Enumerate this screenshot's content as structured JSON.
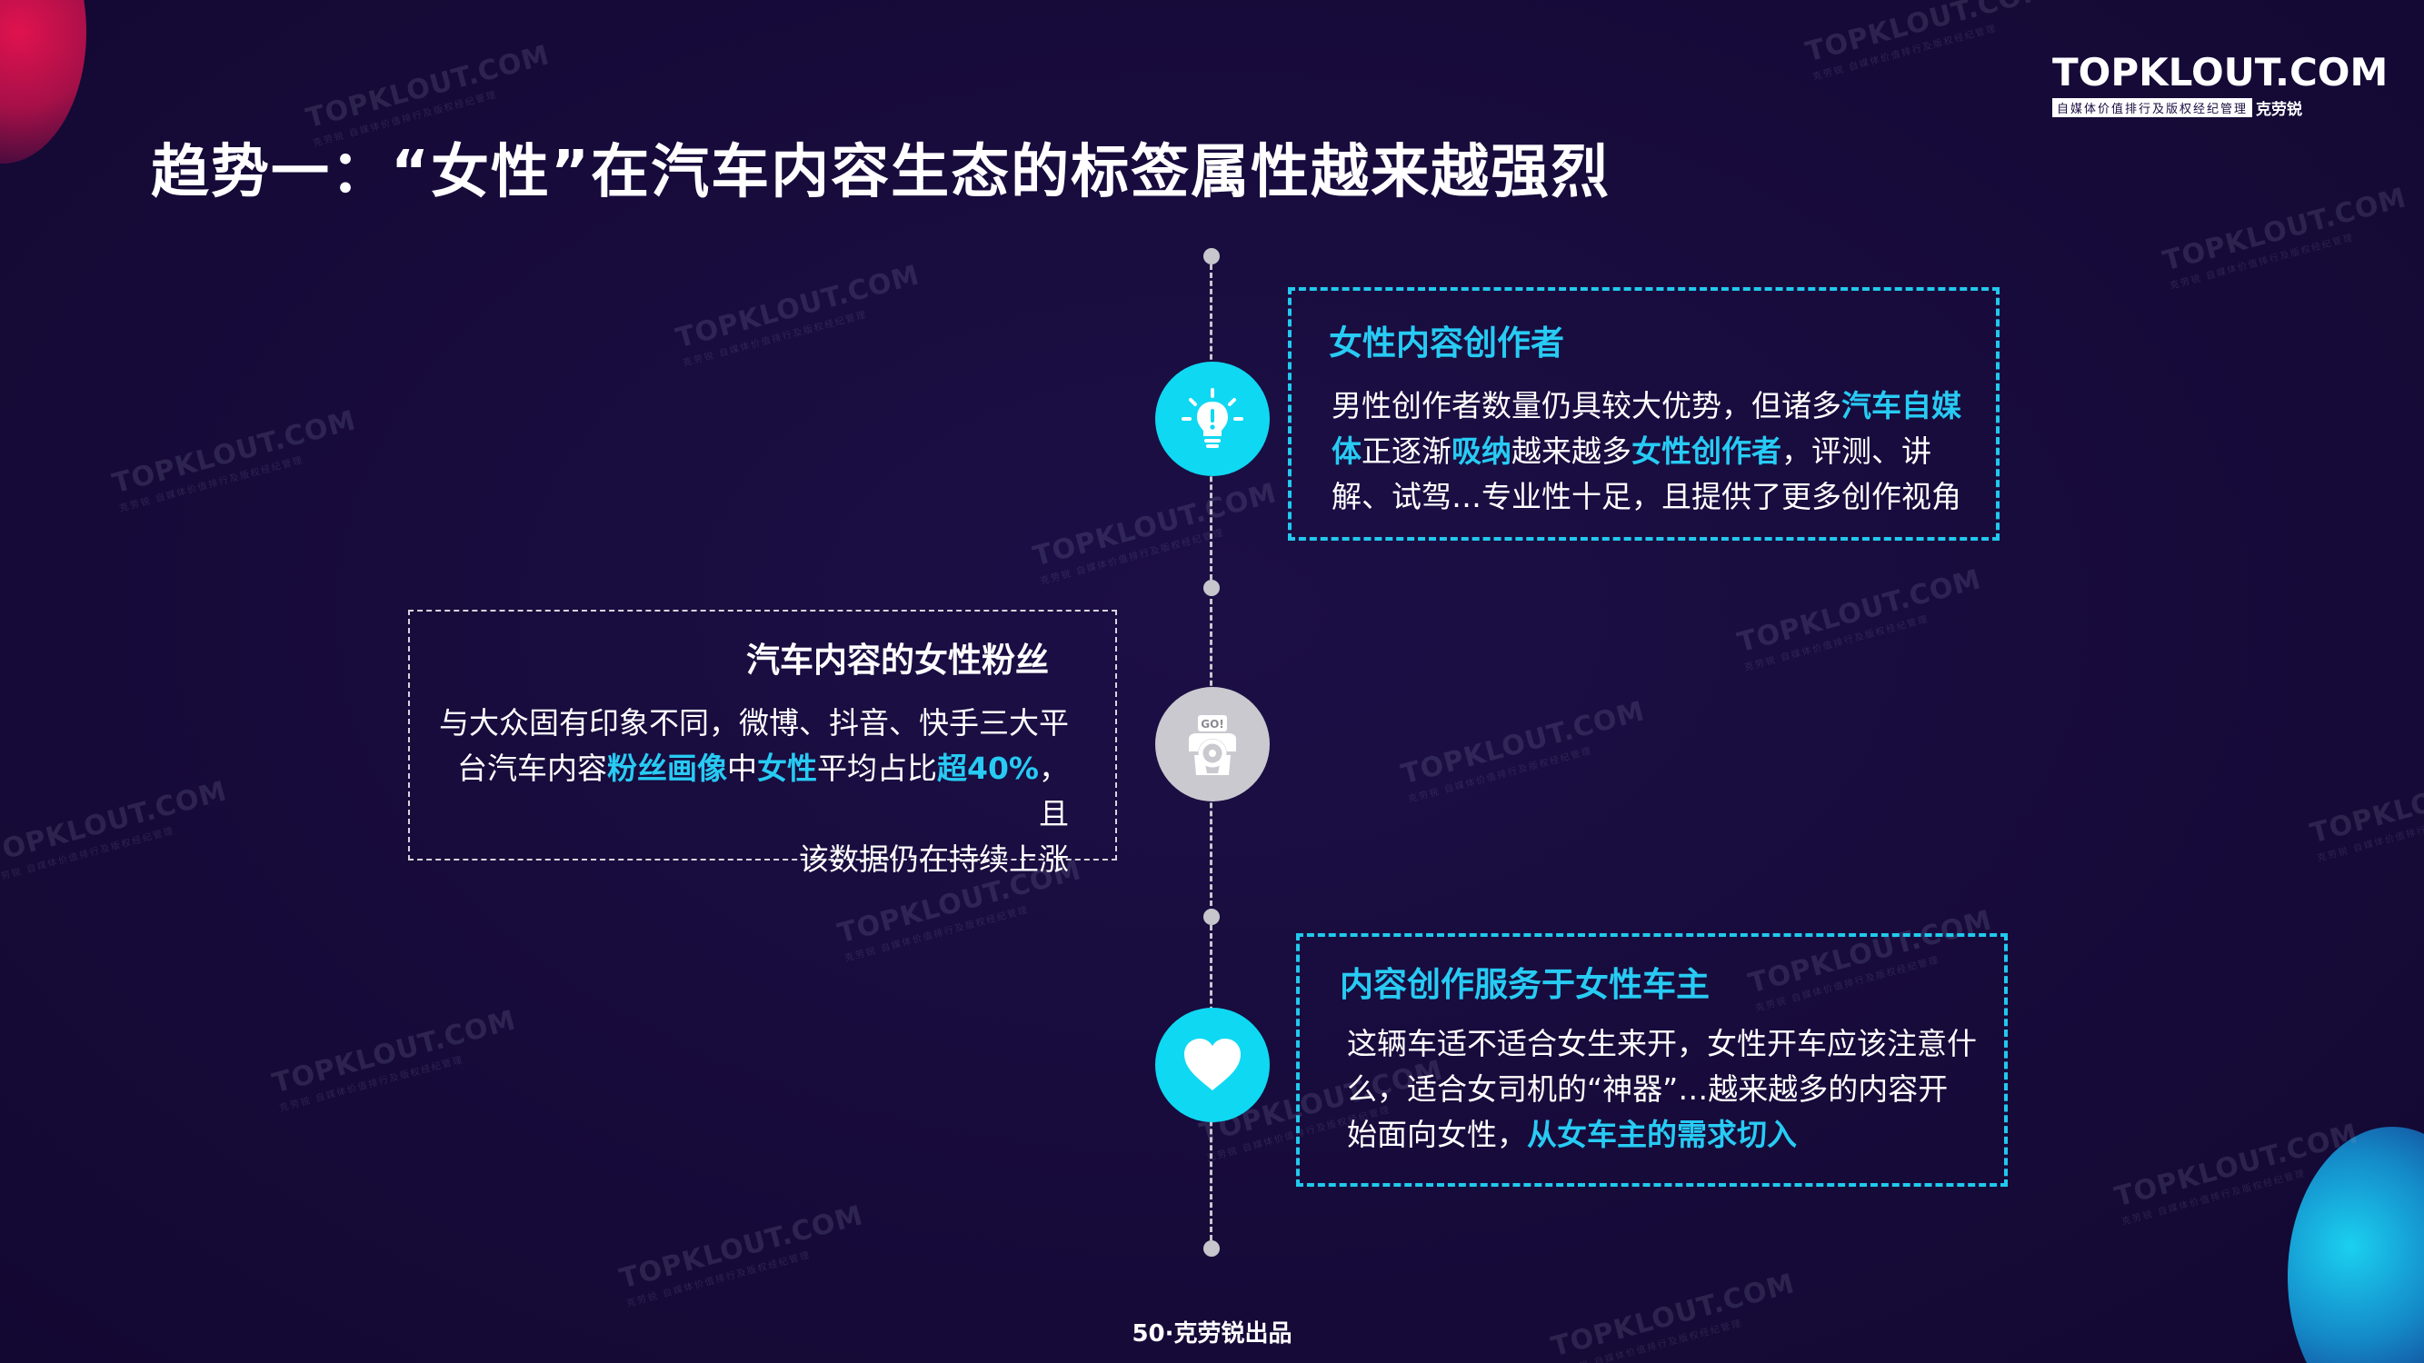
{
  "title": "趋势一：“女性”在汽车内容生态的标签属性越来越强烈",
  "logo": {
    "main": "TOPKLOUT.COM",
    "tagline": "自媒体价值排行及版权经纪管理",
    "brand_cn": "克劳锐"
  },
  "watermark": {
    "text": "TOPKLOUT.COM",
    "sub": "克劳锐 自媒体价值排行及版权经纪管理"
  },
  "sections": [
    {
      "icon": "lightbulb-icon",
      "title": "女性内容创作者",
      "body_lines": [
        [
          {
            "t": "男性创作者数量仍具较大优势，但诸多"
          },
          {
            "t": "汽车自媒",
            "hl": true
          }
        ],
        [
          {
            "t": "体",
            "hl": true
          },
          {
            "t": "正逐渐"
          },
          {
            "t": "吸纳",
            "hl": true
          },
          {
            "t": "越来越多"
          },
          {
            "t": "女性创作者",
            "hl": true
          },
          {
            "t": "，评测、讲"
          }
        ],
        [
          {
            "t": "解、试驾…专业性十足，且提供了更多创作视角"
          }
        ]
      ]
    },
    {
      "icon": "driver-steering-wheel-icon",
      "icon_label": "GO!",
      "title": "汽车内容的女性粉丝",
      "body_lines": [
        [
          {
            "t": "与大众固有印象不同，微博、抖音、快手三大平"
          }
        ],
        [
          {
            "t": "台汽车内容"
          },
          {
            "t": "粉丝画像",
            "hl": true
          },
          {
            "t": "中"
          },
          {
            "t": "女性",
            "hl": true
          },
          {
            "t": "平均占比"
          },
          {
            "t": "超40%",
            "hl": true
          },
          {
            "t": "，且"
          }
        ],
        [
          {
            "t": "该数据仍在持续上涨"
          }
        ]
      ]
    },
    {
      "icon": "heart-icon",
      "title": "内容创作服务于女性车主",
      "body_lines": [
        [
          {
            "t": "这辆车适不适合女生来开，女性开车应该注意什"
          }
        ],
        [
          {
            "t": "么，适合女司机的“神器”…越来越多的内容开"
          }
        ],
        [
          {
            "t": "始面向女性，"
          },
          {
            "t": "从女车主的需求切入",
            "hl": true
          }
        ]
      ]
    }
  ],
  "footer": "50·克劳锐出品",
  "colors": {
    "background": "#1a0c40",
    "accent_cyan": "#22c9ee",
    "node_gray": "#c9c9cf",
    "text": "#ffffff"
  }
}
